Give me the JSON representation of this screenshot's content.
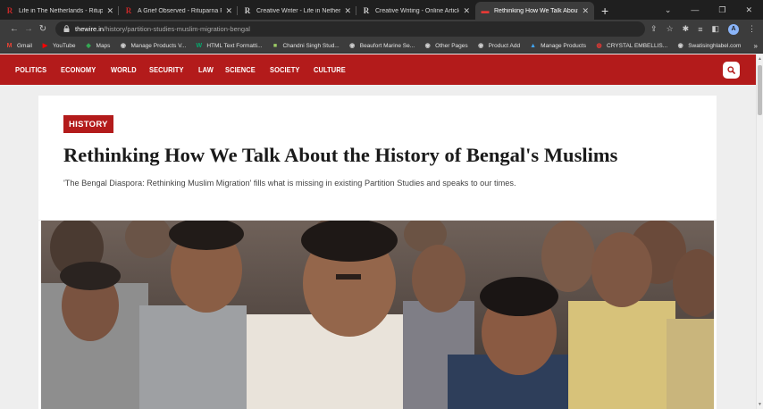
{
  "browser": {
    "tabs": [
      {
        "title": "Life in The Netherlands - Rituparna",
        "favicon": "R",
        "favicon_color": "#c62828",
        "active": false
      },
      {
        "title": "A Grief Observed - Rituparna Roy",
        "favicon": "R",
        "favicon_color": "#c62828",
        "active": false
      },
      {
        "title": "Creative Writer - Life in Netherlands",
        "favicon": "R",
        "favicon_color": "#cfcfcf",
        "active": false
      },
      {
        "title": "Creative Writing - Online Articles",
        "favicon": "R",
        "favicon_color": "#cfcfcf",
        "active": false
      },
      {
        "title": "Rethinking How We Talk About the",
        "favicon": "▬",
        "favicon_color": "#e53935",
        "active": true
      }
    ],
    "new_tab": "+",
    "window_controls": {
      "chevron": "⌄",
      "minimize": "—",
      "restore": "❐",
      "close": "✕"
    },
    "url": {
      "host": "thewire.in",
      "path": "/history/partition-studies-muslim-migration-bengal"
    },
    "profile_initial": "A",
    "bookmarks": [
      {
        "label": "Gmail",
        "icon": "M",
        "color": "#ea4335"
      },
      {
        "label": "YouTube",
        "icon": "▶",
        "color": "#ff0000"
      },
      {
        "label": "Maps",
        "icon": "◆",
        "color": "#34a853"
      },
      {
        "label": "Manage Products V...",
        "icon": "◉",
        "color": "#d0d0d0"
      },
      {
        "label": "HTML Text Formatti...",
        "icon": "W",
        "color": "#04aa6d"
      },
      {
        "label": "Chandni Singh Stud...",
        "icon": "■",
        "color": "#9ccc65"
      },
      {
        "label": "Beaufort Marine Se...",
        "icon": "◉",
        "color": "#d0d0d0"
      },
      {
        "label": "Other Pages",
        "icon": "◉",
        "color": "#d0d0d0"
      },
      {
        "label": "Product Add",
        "icon": "◉",
        "color": "#d0d0d0"
      },
      {
        "label": "Manage Products",
        "icon": "▲",
        "color": "#42a5f5"
      },
      {
        "label": "CRYSTAL EMBELLIS...",
        "icon": "◍",
        "color": "#e53935"
      },
      {
        "label": "Swatisinghlabel.com",
        "icon": "◉",
        "color": "#d0d0d0"
      }
    ],
    "bookmarks_overflow": "»"
  },
  "site": {
    "nav": [
      "POLITICS",
      "ECONOMY",
      "WORLD",
      "SECURITY",
      "LAW",
      "SCIENCE",
      "SOCIETY",
      "CULTURE"
    ],
    "brand_color": "#b31b1b"
  },
  "article": {
    "category": "HISTORY",
    "title": "Rethinking How We Talk About the History of Bengal's Muslims",
    "standfirst": "'The Bengal Diaspora: Rethinking Muslim Migration' fills what is missing in existing Partition Studies and speaks to our times."
  }
}
